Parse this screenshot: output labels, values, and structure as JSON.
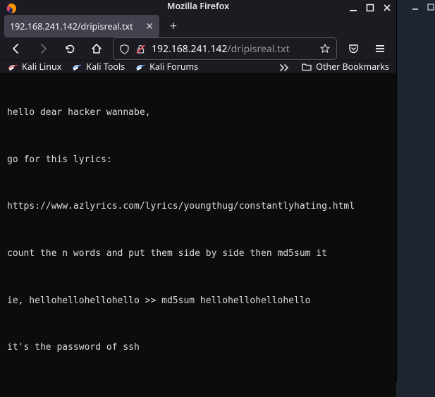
{
  "window": {
    "title": "Mozilla Firefox"
  },
  "tab": {
    "title": "192.168.241.142/dripisreal.txt"
  },
  "url": {
    "host": "192.168.241.142",
    "path": "/dripisreal.txt"
  },
  "bookmarks": {
    "kali_linux": "Kali Linux",
    "kali_tools": "Kali Tools",
    "kali_forums": "Kali Forums",
    "other": "Other Bookmarks"
  },
  "page": {
    "line1": "hello dear hacker wannabe,",
    "line2": "go for this lyrics:",
    "line3": "https://www.azlyrics.com/lyrics/youngthug/constantlyhating.html",
    "line4": "count the n words and put them side by side then md5sum it",
    "line5": "ie, hellohellohellohello >> md5sum hellohellohellohello",
    "line6": "it's the password of ssh"
  }
}
